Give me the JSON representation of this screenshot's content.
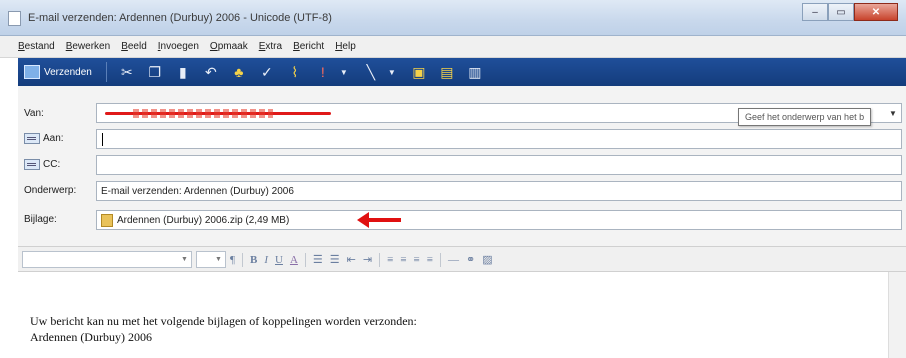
{
  "window": {
    "title": "E-mail verzenden: Ardennen (Durbuy) 2006 - Unicode (UTF-8)",
    "buttons": {
      "minimize": "–",
      "maximize": "▭",
      "close": "✕"
    }
  },
  "menu": [
    "Bestand",
    "Bewerken",
    "Beeld",
    "Invoegen",
    "Opmaak",
    "Extra",
    "Bericht",
    "Help"
  ],
  "toolbar": {
    "send_label": "Verzenden",
    "icons": [
      "cut-icon",
      "copy-icon",
      "paste-icon",
      "undo-icon",
      "address-book-icon",
      "spellcheck-icon",
      "attach-icon",
      "priority-icon",
      "sign-icon",
      "encrypt-icon",
      "offline-icon"
    ]
  },
  "headers": {
    "from_label": "Van:",
    "to_label": "Aan:",
    "cc_label": "CC:",
    "subject_label": "Onderwerp:",
    "subject_value": "E-mail verzenden: Ardennen (Durbuy) 2006",
    "attachment_label": "Bijlage:",
    "attachment_value": "Ardennen (Durbuy) 2006.zip (2,49 MB)"
  },
  "tooltip": "Geef het onderwerp van het b",
  "format_toolbar": {
    "buttons": [
      "B",
      "I",
      "U",
      "A"
    ]
  },
  "body": {
    "line1": "Uw bericht kan nu met het volgende bijlagen of koppelingen worden verzonden:",
    "line2": "Ardennen (Durbuy) 2006"
  },
  "colors": {
    "toolbar_bg": "#1f4f9a",
    "annotation_red": "#e01010"
  }
}
